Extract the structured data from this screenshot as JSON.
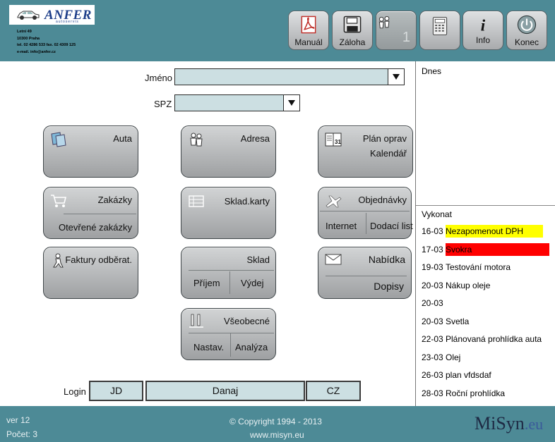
{
  "header": {
    "logo": {
      "name": "ANFER",
      "sub": "autoservis"
    },
    "address": [
      "Letní 49",
      "10300 Praha",
      "tel. 02 4286 533  fax. 02 4309 125",
      "e-mail. info@anfer.cz"
    ],
    "toolbar": [
      {
        "label": "Manuál",
        "icon": "pdf-icon"
      },
      {
        "label": "Záloha",
        "icon": "floppy-icon"
      },
      {
        "label": "",
        "icon": "users-icon",
        "count": "1"
      },
      {
        "label": "",
        "icon": "calculator-icon"
      },
      {
        "label": "Info",
        "icon": "info-icon"
      },
      {
        "label": "Konec",
        "icon": "power-icon"
      }
    ]
  },
  "form": {
    "name_label": "Jméno",
    "name_value": "",
    "spz_label": "SPZ",
    "spz_value": ""
  },
  "buttons": {
    "auta": "Auta",
    "adresa": "Adresa",
    "plan_1": "Plán oprav",
    "plan_2": "Kalendář",
    "zakazky": "Zakázky",
    "otevrene": "Otevřené zakázky",
    "sklad_karty": "Sklad.karty",
    "objednavky": "Objednávky",
    "internet": "Internet",
    "dodaci": "Dodací list",
    "faktury": "Faktury odběrat.",
    "sklad": "Sklad",
    "prijem": "Příjem",
    "vydej": "Výdej",
    "nabidka": "Nabídka",
    "dopisy": "Dopisy",
    "vseobecne": "Všeobecné",
    "nastav": "Nastav.",
    "analyza": "Analýza"
  },
  "right_panel": {
    "today_label": "Dnes",
    "todo_label": "Vykonat",
    "todo": [
      {
        "date": "16-03",
        "text": "Nezapomenout DPH",
        "highlight": "#ffff00"
      },
      {
        "date": "17-03",
        "text": "Svokra",
        "highlight": "#ff0000"
      },
      {
        "date": "19-03",
        "text": "Testování motora"
      },
      {
        "date": "20-03",
        "text": "Nákup oleje"
      },
      {
        "date": "20-03",
        "text": ""
      },
      {
        "date": "20-03",
        "text": "Svetla"
      },
      {
        "date": "22-03",
        "text": "Plánovaná prohlídka auta"
      },
      {
        "date": "23-03",
        "text": "Olej"
      },
      {
        "date": "26-03",
        "text": "plan vfdsdaf"
      },
      {
        "date": "28-03",
        "text": "Roční prohlídka"
      }
    ]
  },
  "login": {
    "label": "Login",
    "user": "JD",
    "name": "Danaj",
    "lang": "CZ"
  },
  "footer": {
    "version": "ver 12",
    "count": "Počet: 3",
    "copyright": "©  Copyright 1994 - 2013",
    "url": "www.misyn.eu",
    "brand_main": "MiSyn",
    "brand_ext": ".eu"
  },
  "colors": {
    "header": "#4d8a96",
    "field": "#ccdfe2"
  }
}
